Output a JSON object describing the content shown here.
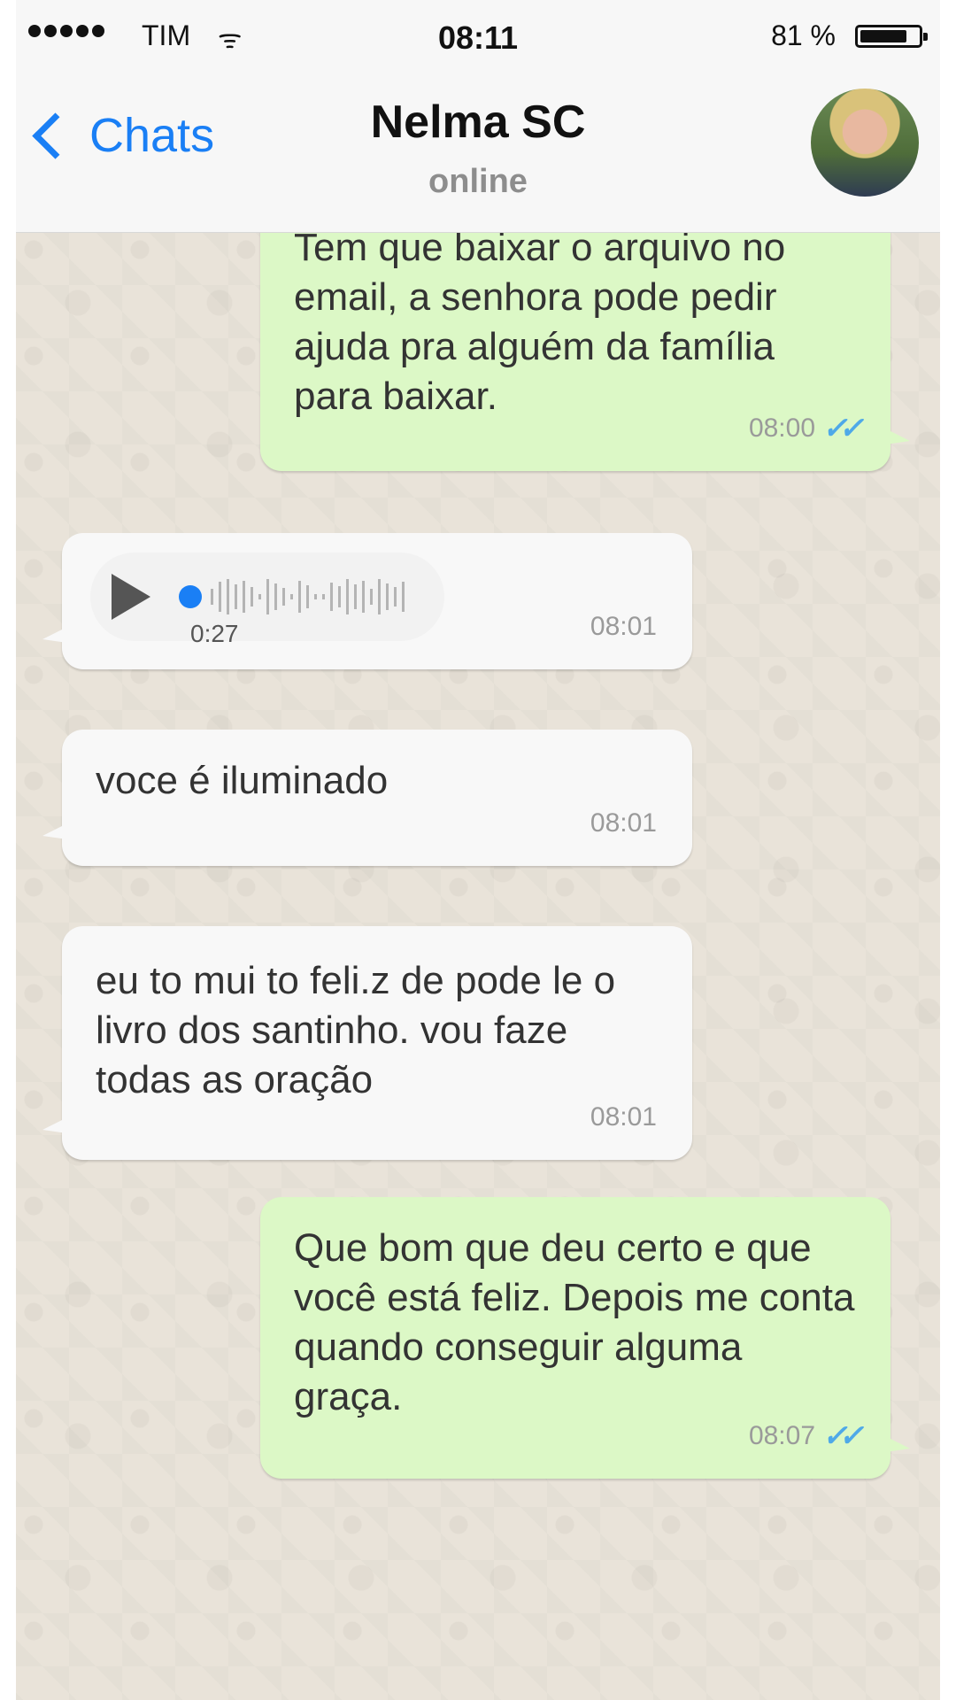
{
  "status_bar": {
    "carrier": "TIM",
    "time": "08:11",
    "battery": "81 %"
  },
  "header": {
    "back_label": "Chats",
    "contact_name": "Nelma SC",
    "contact_status": "online"
  },
  "messages": [
    {
      "direction": "out",
      "text": "Tem que baixar o arquivo no email, a senhora pode pedir ajuda pra alguém da família para baixar.",
      "time": "08:00",
      "read": true
    },
    {
      "direction": "in",
      "type": "voice",
      "duration": "0:27",
      "time": "08:01"
    },
    {
      "direction": "in",
      "text": "voce é iluminado",
      "time": "08:01"
    },
    {
      "direction": "in",
      "text": "eu to mui to feli.z de pode le o livro dos santinho. vou faze todas as oração",
      "time": "08:01"
    },
    {
      "direction": "out",
      "text": "Que bom que deu certo e que você está feliz. Depois me conta quando conseguir alguma graça.",
      "time": "08:07",
      "read": true
    }
  ],
  "colors": {
    "accent": "#1a7ff5",
    "outgoing_bubble": "#dcf8c6",
    "incoming_bubble": "#f8f8f8",
    "read_ticks": "#4fa9e8"
  }
}
